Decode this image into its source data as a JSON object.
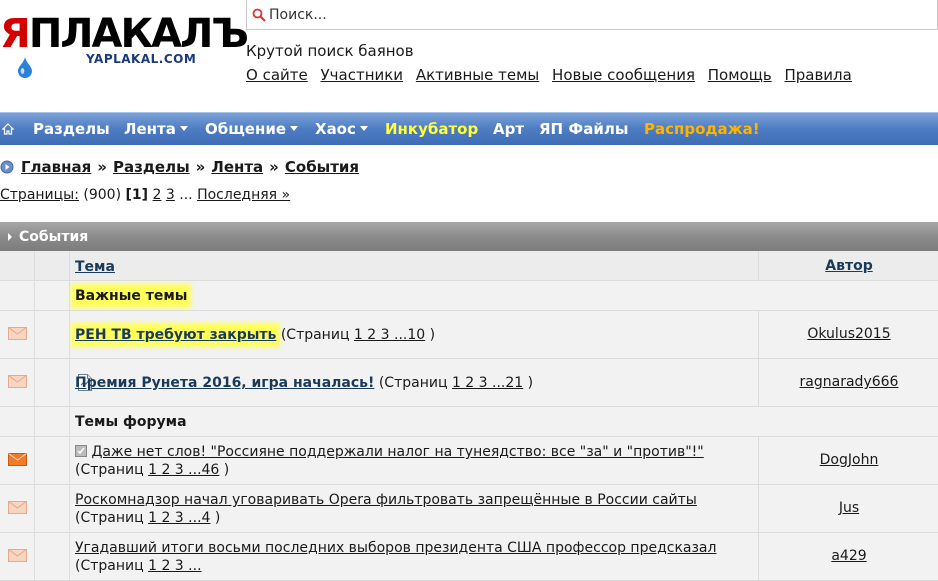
{
  "logo": {
    "main_ya": "Я",
    "main_rest": "ПЛАКАЛЪ",
    "sub": "YAPLAKAL.COM"
  },
  "search": {
    "placeholder": "Поиск..."
  },
  "tagline": "Крутой поиск баянов",
  "top_links": [
    "О сайте",
    "Участники",
    "Активные темы",
    "Новые сообщения",
    "Помощь",
    "Правила"
  ],
  "nav": {
    "items": [
      {
        "label": "Разделы",
        "style": "white",
        "dropdown": false
      },
      {
        "label": "Лента",
        "style": "white",
        "dropdown": true
      },
      {
        "label": "Общение",
        "style": "white",
        "dropdown": true
      },
      {
        "label": "Хаос",
        "style": "white",
        "dropdown": true
      },
      {
        "label": "Инкубатор",
        "style": "yellow",
        "dropdown": false
      },
      {
        "label": "Арт",
        "style": "white",
        "dropdown": false
      },
      {
        "label": "ЯП Файлы",
        "style": "white",
        "dropdown": false
      },
      {
        "label": "Распродажа!",
        "style": "orange",
        "dropdown": false
      }
    ]
  },
  "breadcrumb": [
    "Главная",
    "Разделы",
    "Лента",
    "События"
  ],
  "breadcrumb_sep": "»",
  "pagination": {
    "label": "Страницы:",
    "total": "(900)",
    "current": "[1]",
    "pages": [
      "2",
      "3"
    ],
    "ellipsis": "...",
    "last": "Последняя »"
  },
  "forum": {
    "section_title": "События",
    "col_topic": "Тема",
    "col_author": "Автор",
    "important_title": "Важные темы",
    "forum_title": "Темы форума",
    "pages_prefix": "(Страниц",
    "pages_suffix": ")",
    "important": [
      {
        "title": "РЕН ТВ требуют закрыть",
        "pages": "1 2 3 ...10",
        "author": "Okulus2015"
      },
      {
        "title": "Премия Рунета 2016, игра началась!",
        "pages": "1 2 3 ...21",
        "author": "ragnarady666"
      }
    ],
    "topics": [
      {
        "title": "Даже нет слов! \"Россияне поддержали налог на тунеядство: все \"за\" и \"против\"!\"",
        "pages": "1 2 3 ...46",
        "author": "DogJohn"
      },
      {
        "title": "Роскомнадзор начал уговаривать Opera фильтровать запрещённые в России сайты",
        "pages": "1 2 3 ...4",
        "author": "Jus"
      },
      {
        "title": "Угадавший итоги восьми последних выборов президента США профессор предсказал",
        "pages": "1 2 3 ...",
        "author": "a429"
      }
    ]
  },
  "colors": {
    "nav": "#4f7dc3",
    "section_bar": "#8a8a8a",
    "highlight": "#ffff5a",
    "accent_yellow": "#ffff3a",
    "accent_orange": "#ffb400"
  }
}
